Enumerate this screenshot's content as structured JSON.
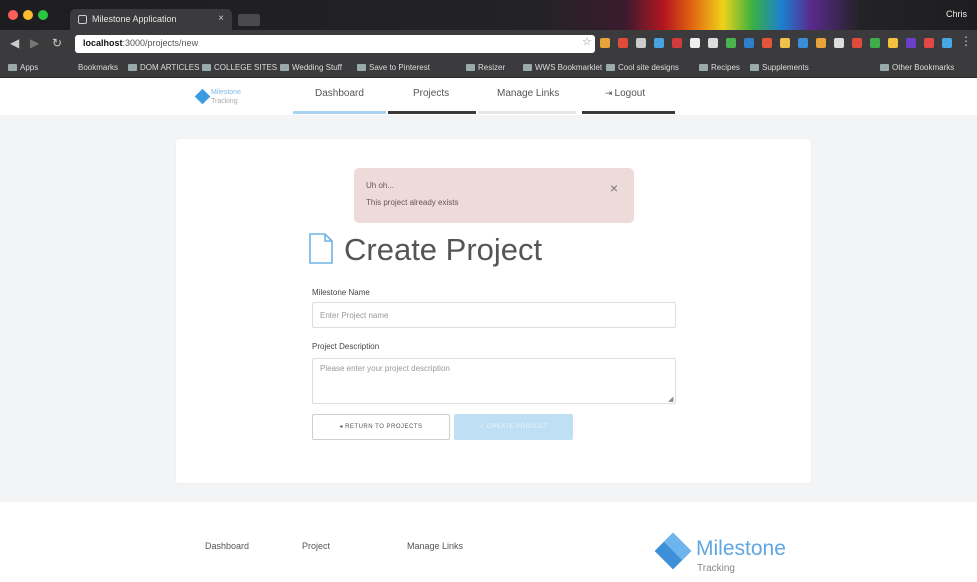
{
  "browser": {
    "tab_title": "Milestone Application",
    "tab_close": "×",
    "user_name": "Chris",
    "url_host": "localhost",
    "url_path": ":3000/projects/new",
    "bookmarks": [
      "Apps",
      "Bookmarks",
      "DOM ARTICLES",
      "COLLEGE SITES",
      "Wedding Stuff",
      "Save to Pinterest",
      "Resizer",
      "WWS Bookmarklet",
      "Cool site designs",
      "Recipes",
      "Supplements"
    ],
    "other_bookmarks": "Other Bookmarks"
  },
  "nav": {
    "logo_name": "Milestone",
    "logo_sub": "Tracking",
    "items": [
      "Dashboard",
      "Projects",
      "Manage Links",
      "Logout"
    ],
    "colors": {
      "active_underline": "#a8d4f2",
      "underline": "#3a3a3a"
    }
  },
  "alert": {
    "title": "Uh oh...",
    "message": "This project already exists",
    "close_symbol": "×",
    "background": "#efdada"
  },
  "form": {
    "title": "Create Project",
    "name_label": "Milestone Name",
    "name_placeholder": "Enter Project name",
    "desc_label": "Project Description",
    "desc_placeholder": "Please enter your project description",
    "return_button": "◂ RETURN TO PROJECTS",
    "create_button": "✓ CREATE PROJECT",
    "accent": "#bfdff4"
  },
  "footer": {
    "links": [
      "Dashboard",
      "Project",
      "Manage Links"
    ],
    "logo_name": "Milestone",
    "logo_sub": "Tracking",
    "brand_color": "#5fa6e2"
  }
}
